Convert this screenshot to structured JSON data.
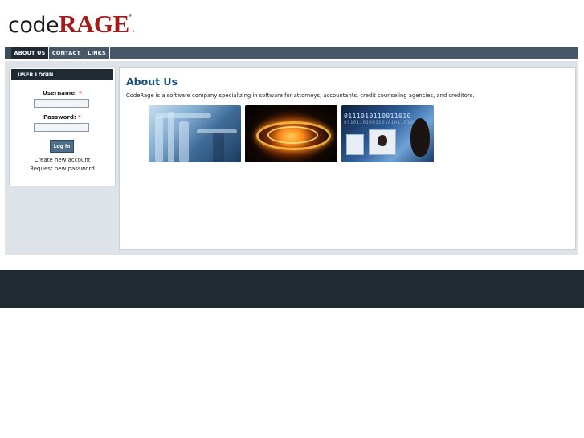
{
  "logo": {
    "part1": "code",
    "part2": "RAGE"
  },
  "nav": {
    "items": [
      "ABOUT US",
      "CONTACT",
      "LINKS"
    ],
    "active": "ABOUT US"
  },
  "login": {
    "title": "USER LOGIN",
    "username_label": "Username:",
    "password_label": "Password:",
    "required_mark": "*",
    "submit": "Log in",
    "create_account": "Create new account",
    "request_password": "Request new password"
  },
  "content": {
    "heading": "About Us",
    "body": "CodeRage is a software company specializing in software for attorneys, accountants, credit counseling agencies, and creditors.",
    "binary_text": "0111010110011010",
    "binary_text_small": "01101101001101010110100"
  },
  "colors": {
    "nav": "#465868",
    "nav_active": "#1f2a33",
    "heading": "#1b4f7a",
    "logo_red": "#a61a1a",
    "footer": "#1f2a33",
    "panel": "#dde3e8"
  }
}
